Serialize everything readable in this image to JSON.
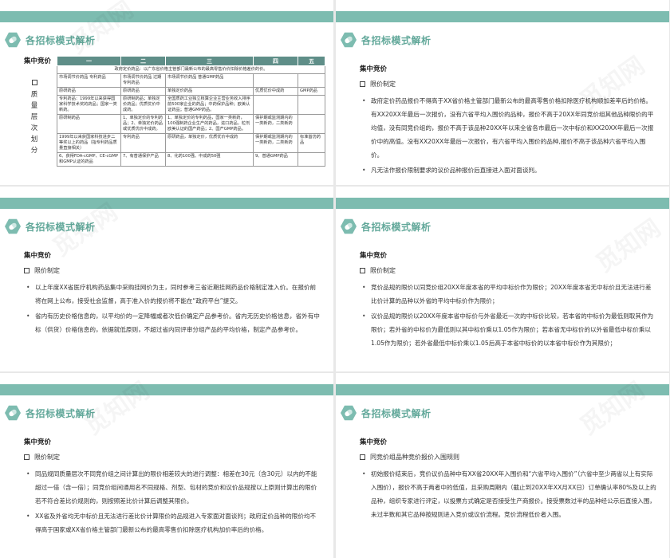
{
  "slide_title": "各招标模式解析",
  "subtitle": "集中竞价",
  "watermark": "觅知网",
  "slides": [
    {
      "table": {
        "side_label": "质量层次划分",
        "headers": [
          "一",
          "二",
          "三",
          "四",
          "五"
        ],
        "note": "政府定价药品：以广东省价格主管部门最新公布的最高零售价价扣除价格差价的价。",
        "rows": [
          [
            "市场调节价药品 专利药品",
            "市场调节价药品 过期专利药品",
            "市场调节价药品 普通GMP药品",
            "",
            ""
          ],
          [
            "原研药品",
            "原研药品",
            "单独定价药品",
            "优质优价中成药",
            "GMP药品"
          ],
          [
            "专利药品：1999年以来获得国家科学技术奖的药品；国家一类新药。",
            "原研制药品；单独定价药品；优质优价中成药。",
            "全国质药工业独立核算企业主营业务收入排序前500家企业的药品；中药保护品种；欧美认证药品；普通GMP药品。",
            "",
            ""
          ],
          [
            "原研制药品",
            "1、单独定价的专利药品；2、单独定价药品或优质优价中成药。",
            "1、单独定价的专利药品，国家一类新药，100强制药企业生产的药品，进口药品，粒剂欧美认证的国产药品；2、国产GMP药品。",
            "保护期或监测期内的一类新药，二类新药",
            ""
          ],
          [
            "1999年以来获国家科技进步二等奖以上的药品（指专利药品质量直接相关）",
            "专利药品",
            "原研药品，单独定价，优质优价中成药",
            "保护期或监测期内的一类新药，二类新药",
            "标准首仿药品"
          ],
          [
            "6、获得FDA-cGMP、CE-cGMP和GMP认证的药品",
            "7、有普通保护产品",
            "8、化药100强、中成药50强",
            "9、普通GMP药品",
            ""
          ]
        ]
      }
    },
    {
      "section": "限价制定",
      "items": [
        "政府定价药品报价不得高于XX省价格主管部门最新公布的最高零售价格扣除医疗机构顺加差率后的价格。有XX20XX年最后一次报价，没有六省平均入围价的品种，报价不高于20XX年同竞价组其他品种限价的平均值，没有同竞价组的，报价不高于该品种20XX年以来全省各市最后一次中标价和XX20XX年最后一次报价中的高值。没有XX20XX年最后一次报价，有六省平均入围价的品种,报价不高于该品种六省平均入围价。",
        "凡无法作报价限制要求的议价品种报价后直接进入面对面谈判。"
      ]
    },
    {
      "section": "限价制定",
      "items": [
        "以上年度XX省医疗机构药品集中采购挂网价为主，同时参考三省近期挂网药品价格制定准入价。在报价前将在网上公布，接受社会监督，高于准入价的报价将不能在“政府平台”提交。",
        "省内有历史价格信息的，以平均价的一定降幅或者次低价确定产品参考价。省内无历史价格信息，省外有中标（供货）价格信息的，依据就低原则，不超过省内同评审分组产品的平均价格，制定产品参考价。"
      ]
    },
    {
      "section": "限价制定",
      "items": [
        "竞价品规的限价以同竞价组20XX年度本省的平均中标价作为限价；20XX年度本省无中标价且无法进行差比价计算的品种以外省的平均中标价作为限价；",
        "议价品规的限价以20XX年度本省中标价与外省最近一次的中标价比较，若本省的中标价为最低则取其作为限价；若外省的中标价为最低则以其中标价乘以1.05作为限价；若本省无中标价的以外省最低中标价乘以1.05作为限价；若外省最低中标价乘以1.05后高于本省中标价的以本省中标价作为其限价；"
      ]
    },
    {
      "section": "限价制定",
      "items": [
        "同品规同质量层次不同竞价组之间计算出的限价相差较大的进行调整：相差在30元（含30元）以内的不能超过一倍（含一倍）；同竞价组间通用名不同规格、剂型、包材的竞价和议价品规按以上原则计算出的限价若不符合差比价规则的，则按照差比价计算后调整其限价。",
        "XX省及外省均无中标价且无法进行差比价计算限价的品规进入专家面对面谈判；政府定价品种的限价均不得高于国家或XX省价格主管部门最新公布的最高零售价扣除医疗机构加价率后的价格。"
      ]
    },
    {
      "section": "同竞价组品种竞价报价入围规则",
      "items": [
        "初始报价结束后，竞价议价品种中有XX省20XX年入围价和“六省平均入围价”（六省中至少两省以上有实际入围价），报价不高于两者中的低值，且采购周期内（截止到20XX年XX月XX日）订单确认率80%及以上的品种，组织专家进行评定，以投票方式确定是否接受生产商报价。接受票数过半的品种经公示后直接入围，未过半数和其它品种按规则进入竞价或议价流程。竞价流程低价者入围。"
      ]
    }
  ]
}
